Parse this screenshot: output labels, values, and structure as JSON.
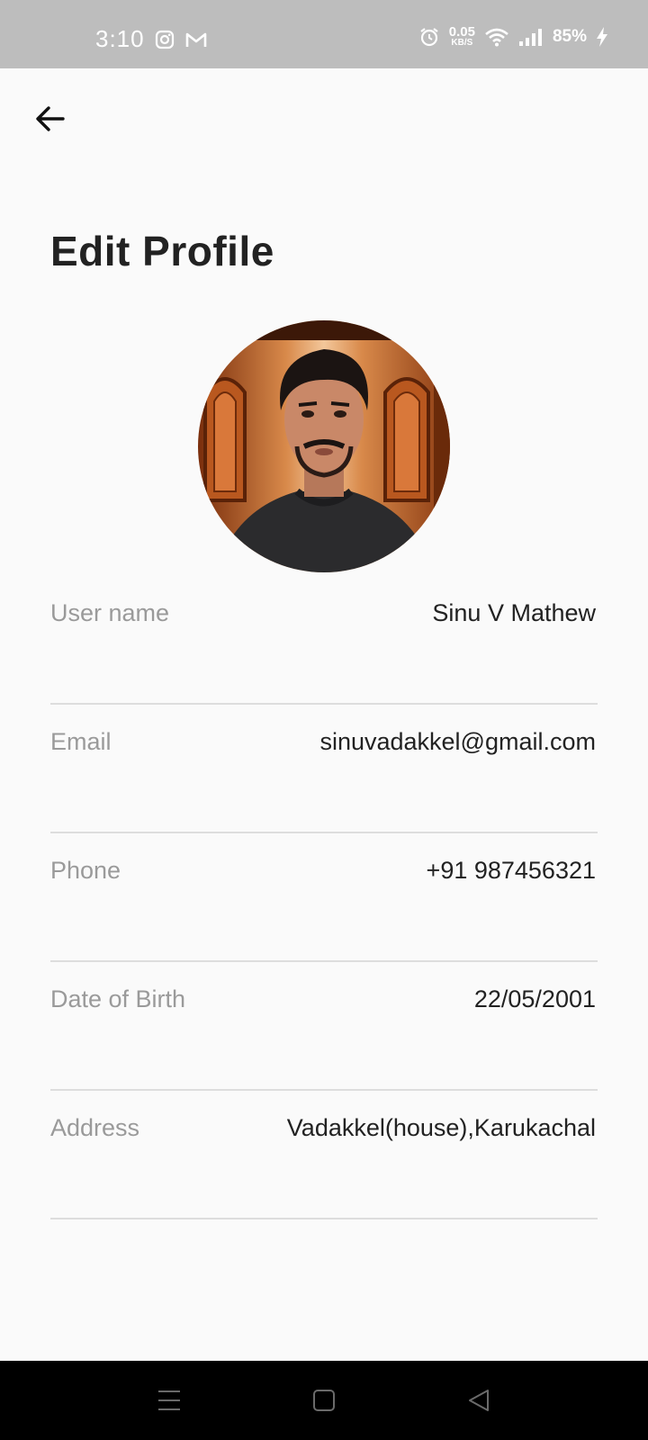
{
  "status_bar": {
    "time": "3:10",
    "net_speed_value": "0.05",
    "net_speed_unit": "KB/S",
    "battery": "85%",
    "icons": [
      "instagram-icon",
      "gmail-icon",
      "alarm-icon",
      "wifi-icon",
      "signal-icon",
      "charging-icon"
    ]
  },
  "header": {
    "back_icon": "arrow-left-icon",
    "title": "Edit Profile"
  },
  "profile": {
    "avatar_icon": "profile-photo"
  },
  "fields": [
    {
      "label": "User name",
      "value": "Sinu V Mathew"
    },
    {
      "label": "Email",
      "value": "sinuvadakkel@gmail.com"
    },
    {
      "label": "Phone",
      "value": "+91 987456321"
    },
    {
      "label": "Date of Birth",
      "value": "22/05/2001"
    },
    {
      "label": "Address",
      "value": "Vadakkel(house),Karukachal"
    }
  ],
  "nav_bar": {
    "icons": [
      "menu-icon",
      "home-icon",
      "back-icon"
    ]
  },
  "colors": {
    "status_bar": "#bdbdbd",
    "background": "#fafafa",
    "title": "#222222",
    "label": "#9a9a9a",
    "divider": "#dddddd"
  }
}
